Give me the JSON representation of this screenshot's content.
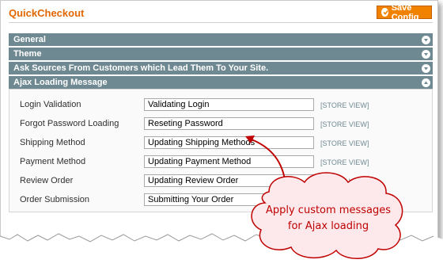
{
  "page": {
    "title": "QuickCheckout"
  },
  "toolbar": {
    "save_label": "Save Config",
    "save_icon": "check-circle-icon"
  },
  "sections": [
    {
      "label": "General",
      "state": "collapsed"
    },
    {
      "label": "Theme",
      "state": "collapsed"
    },
    {
      "label": "Ask Sources From Customers which Lead Them To Your Site.",
      "state": "collapsed"
    },
    {
      "label": "Ajax Loading Message",
      "state": "expanded"
    }
  ],
  "ajax_messages": {
    "scope_label": "[STORE VIEW]",
    "rows": [
      {
        "label": "Login Validation",
        "value": "Validating Login"
      },
      {
        "label": "Forgot Password Loading",
        "value": "Reseting Password"
      },
      {
        "label": "Shipping Method",
        "value": "Updating Shipping Methods"
      },
      {
        "label": "Payment Method",
        "value": "Updating Payment Method"
      },
      {
        "label": "Review Order",
        "value": "Updating Review Order"
      },
      {
        "label": "Order Submission",
        "value": "Submitting Your Order"
      }
    ]
  },
  "callout": {
    "line1": "Apply custom messages",
    "line2": "for Ajax loading",
    "fill_color": "#fde9ec",
    "border_color": "#c00000"
  },
  "colors": {
    "accent": "#e26703",
    "section_header": "#6f8992",
    "button": "#f18200"
  }
}
